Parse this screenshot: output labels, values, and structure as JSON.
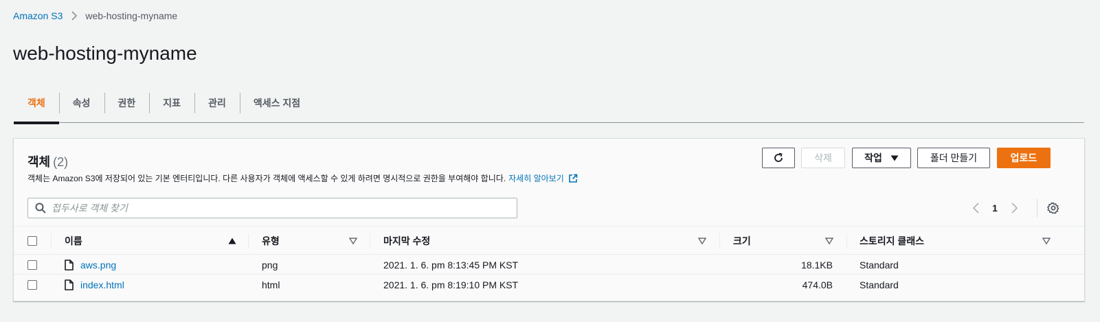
{
  "breadcrumb": {
    "root": "Amazon S3",
    "current": "web-hosting-myname"
  },
  "page_title": "web-hosting-myname",
  "tabs": [
    {
      "label": "객체",
      "active": true
    },
    {
      "label": "속성",
      "active": false
    },
    {
      "label": "권한",
      "active": false
    },
    {
      "label": "지표",
      "active": false
    },
    {
      "label": "관리",
      "active": false
    },
    {
      "label": "액세스 지점",
      "active": false
    }
  ],
  "objects_panel": {
    "title": "객체",
    "count": "(2)",
    "description": "객체는 Amazon S3에 저장되어 있는 기본 엔터티입니다. 다른 사용자가 객체에 액세스할 수 있게 하려면 명시적으로 권한을 부여해야 합니다.",
    "learn_more": "자세히 알아보기",
    "buttons": {
      "delete": "삭제",
      "actions": "작업",
      "create_folder": "폴더 만들기",
      "upload": "업로드"
    },
    "search": {
      "placeholder": "접두사로 객체 찾기",
      "value": ""
    },
    "pagination": {
      "current_page": "1"
    }
  },
  "table": {
    "columns": {
      "name": "이름",
      "type": "유형",
      "last_modified": "마지막 수정",
      "size": "크기",
      "storage_class": "스토리지 클래스"
    },
    "rows": [
      {
        "name": "aws.png",
        "type": "png",
        "last_modified": "2021. 1. 6. pm 8:13:45 PM KST",
        "size": "18.1KB",
        "storage_class": "Standard"
      },
      {
        "name": "index.html",
        "type": "html",
        "last_modified": "2021. 1. 6. pm 8:19:10 PM KST",
        "size": "474.0B",
        "storage_class": "Standard"
      }
    ]
  },
  "colors": {
    "accent": "#ec7211",
    "link": "#0073bb",
    "background": "#f2f3f3"
  },
  "icons": [
    "chevron-right-icon",
    "refresh-icon",
    "caret-down-icon",
    "search-icon",
    "chevron-left-icon",
    "gear-icon",
    "external-link-icon",
    "file-icon",
    "sort-ascending-icon",
    "sort-descending-icon"
  ]
}
